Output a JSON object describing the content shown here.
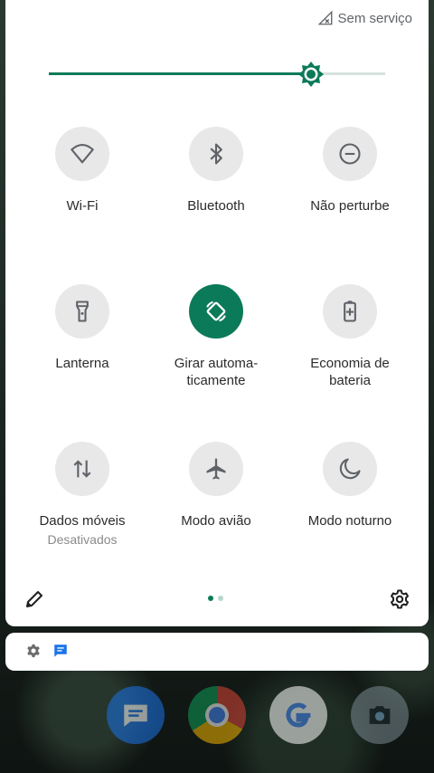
{
  "status": {
    "signal_icon": "no-signal-icon",
    "text": "Sem serviço"
  },
  "brightness": {
    "level_fraction": 0.78
  },
  "tiles": [
    {
      "label": "Wi-Fi",
      "icon": "wifi-icon",
      "active": false
    },
    {
      "label": "Bluetooth",
      "icon": "bluetooth-icon",
      "active": false
    },
    {
      "label": "Não perturbe",
      "icon": "do-not-disturb-icon",
      "active": false
    },
    {
      "label": "Lanterna",
      "icon": "flashlight-icon",
      "active": false
    },
    {
      "label": "Girar automa-\nticamente",
      "icon": "auto-rotate-icon",
      "active": true
    },
    {
      "label": "Economia de\nbateria",
      "icon": "battery-saver-icon",
      "active": false
    },
    {
      "label": "Dados móveis",
      "sub": "Desativados",
      "icon": "mobile-data-icon",
      "active": false
    },
    {
      "label": "Modo avião",
      "icon": "airplane-icon",
      "active": false
    },
    {
      "label": "Modo noturno",
      "icon": "night-mode-icon",
      "active": false
    }
  ],
  "footer": {
    "edit_icon": "pencil-icon",
    "settings_icon": "gear-icon",
    "pages": 2,
    "current_page": 1
  },
  "notification": {
    "icons": [
      "gear-icon",
      "messages-icon"
    ]
  },
  "dock": {
    "apps": [
      "messages-app-icon",
      "chrome-app-icon",
      "google-app-icon",
      "camera-app-icon"
    ]
  },
  "colors": {
    "accent": "#0b7a58",
    "tile_off": "#e8e8e8",
    "panel": "#ffffff"
  }
}
